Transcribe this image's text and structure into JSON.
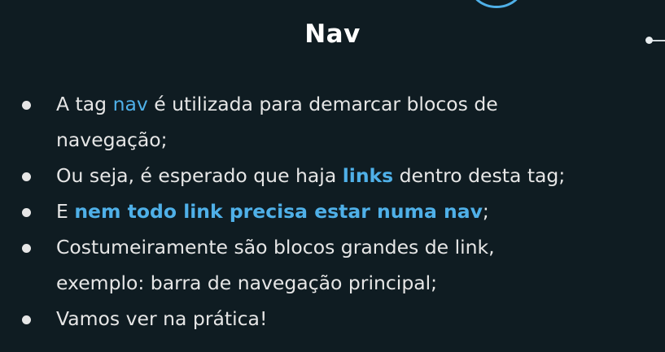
{
  "slide": {
    "title": "Nav",
    "bullets": [
      {
        "line1_before": "A tag ",
        "highlight": "nav",
        "line1_after": " é utilizada para demarcar blocos de",
        "line2": "navegação;"
      },
      {
        "before": "Ou seja, é esperado que haja ",
        "highlight": "links",
        "after": " dentro desta tag;"
      },
      {
        "before": "E ",
        "highlight": "nem todo link precisa estar numa nav",
        "after": ";"
      },
      {
        "line1": "Costumeiramente são blocos grandes de link,",
        "line2": "exemplo: barra de navegação principal;"
      },
      {
        "text": "Vamos ver na prática!"
      }
    ]
  },
  "colors": {
    "background": "#0f1c22",
    "text": "#e6e6e6",
    "accent": "#4fb0e8",
    "title": "#ffffff"
  }
}
